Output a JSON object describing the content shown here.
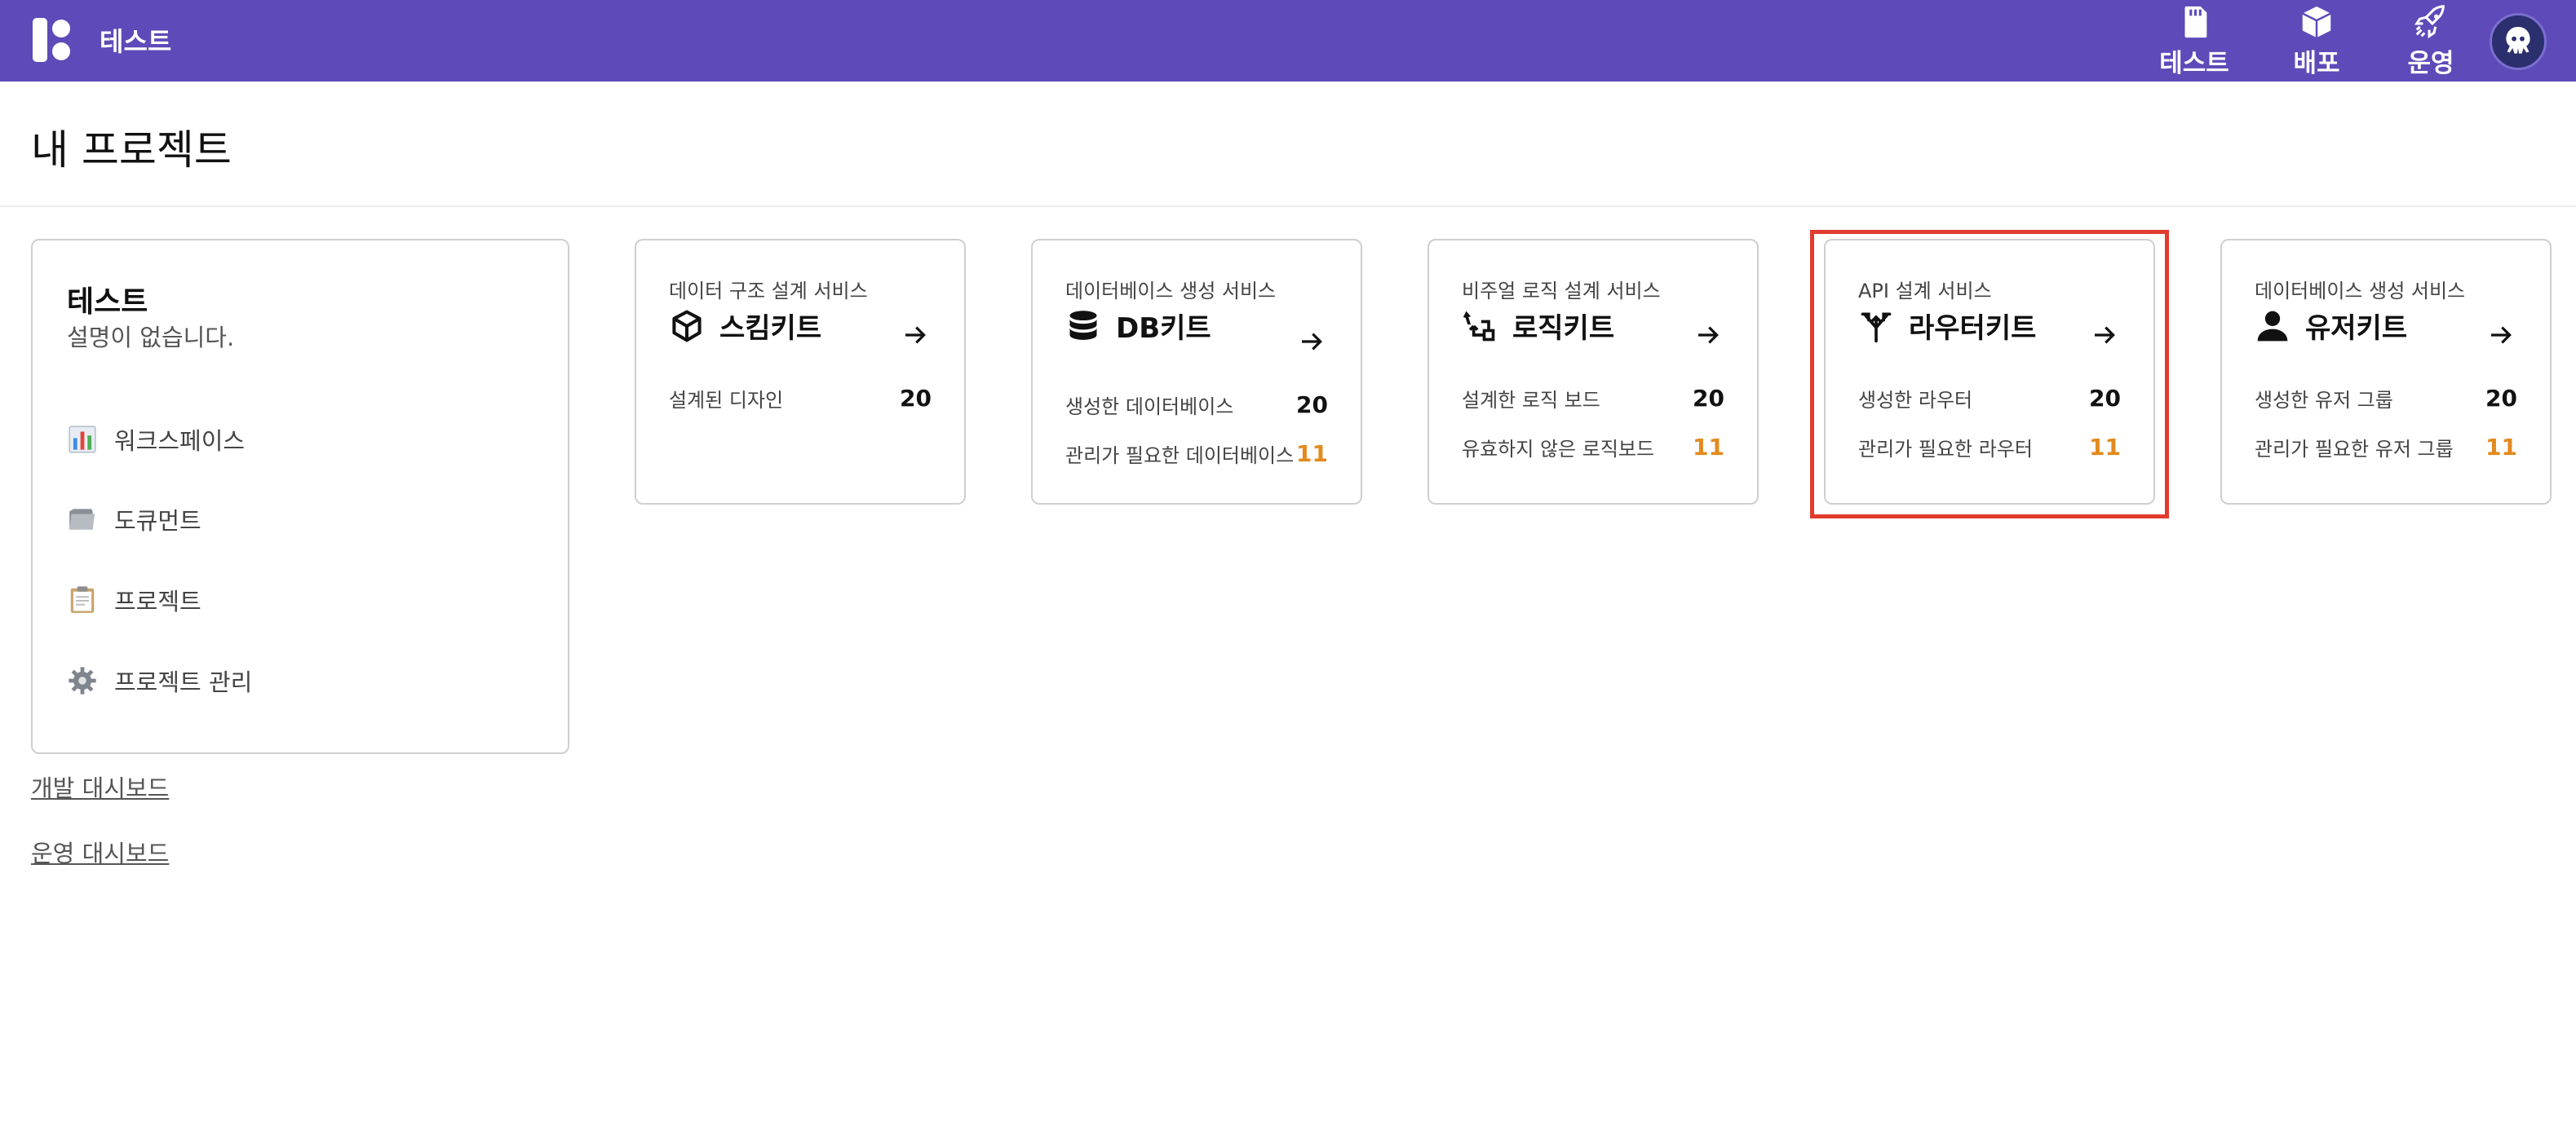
{
  "header": {
    "brand": "테스트",
    "nav": [
      {
        "label": "테스트",
        "icon": "sd-card-icon"
      },
      {
        "label": "배포",
        "icon": "package-icon"
      },
      {
        "label": "운영",
        "icon": "rocket-icon"
      }
    ],
    "avatar_icon": "octopus-avatar-icon"
  },
  "page": {
    "title": "내 프로젝트"
  },
  "project": {
    "name": "테스트",
    "description": "설명이 없습니다.",
    "menu": [
      {
        "label": "워크스페이스",
        "icon": "bar-chart-icon"
      },
      {
        "label": "도큐먼트",
        "icon": "folder-icon"
      },
      {
        "label": "프로젝트",
        "icon": "clipboard-icon"
      },
      {
        "label": "프로젝트 관리",
        "icon": "gear-icon"
      }
    ]
  },
  "links": {
    "dev_dashboard": "개발 대시보드",
    "ops_dashboard": "운영 대시보드"
  },
  "services": [
    {
      "subtitle": "데이터 구조 설계 서비스",
      "name": "스킴키트",
      "icon": "cube-icon",
      "stats": [
        {
          "label": "설계된 디자인",
          "value": "20"
        }
      ]
    },
    {
      "subtitle": "데이터베이스 생성 서비스",
      "name": "DB키트",
      "icon": "database-icon",
      "stats": [
        {
          "label": "생성한 데이터베이스",
          "value": "20"
        },
        {
          "label": "관리가 필요한 데이터베이스",
          "value": "11"
        }
      ]
    },
    {
      "subtitle": "비주얼 로직 설계 서비스",
      "name": "로직키트",
      "icon": "logic-flow-icon",
      "stats": [
        {
          "label": "설계한 로직 보드",
          "value": "20"
        },
        {
          "label": "유효하지 않은 로직보드",
          "value": "11"
        }
      ]
    },
    {
      "subtitle": "API 설계 서비스",
      "name": "라우터키트",
      "icon": "route-split-icon",
      "stats": [
        {
          "label": "생성한 라우터",
          "value": "20"
        },
        {
          "label": "관리가 필요한 라우터",
          "value": "11"
        }
      ]
    },
    {
      "subtitle": "데이터베이스 생성 서비스",
      "name": "유저키트",
      "icon": "user-icon",
      "stats": [
        {
          "label": "생성한 유저 그룹",
          "value": "20"
        },
        {
          "label": "관리가 필요한 유저 그룹",
          "value": "11"
        }
      ]
    }
  ],
  "colors": {
    "header_bg": "#5e4ab8",
    "warning": "#e38a1e",
    "highlight": "#e23b2e"
  }
}
